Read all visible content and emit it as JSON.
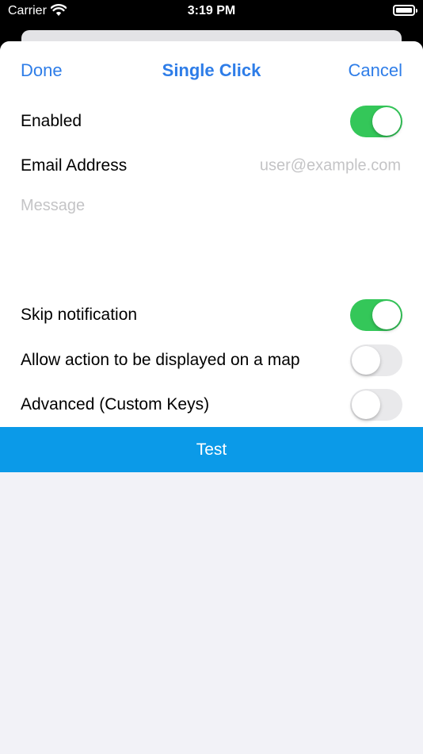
{
  "status_bar": {
    "carrier": "Carrier",
    "time": "3:19 PM"
  },
  "nav": {
    "done_label": "Done",
    "title": "Single Click",
    "cancel_label": "Cancel"
  },
  "form": {
    "enabled": {
      "label": "Enabled",
      "on": true
    },
    "email": {
      "label": "Email Address",
      "placeholder": "user@example.com",
      "value": ""
    },
    "message": {
      "placeholder": "Message",
      "value": ""
    },
    "skip_notification": {
      "label": "Skip notification",
      "on": true
    },
    "allow_map": {
      "label": "Allow action to be displayed on a map",
      "on": false
    },
    "advanced": {
      "label": "Advanced (Custom Keys)",
      "on": false
    }
  },
  "test_button_label": "Test",
  "colors": {
    "accent": "#2e7de8",
    "toggle_on": "#34c759",
    "toggle_off": "#e9e9eb",
    "test_button": "#0b9ae8"
  },
  "icons": [
    "wifi-icon",
    "battery-icon"
  ]
}
